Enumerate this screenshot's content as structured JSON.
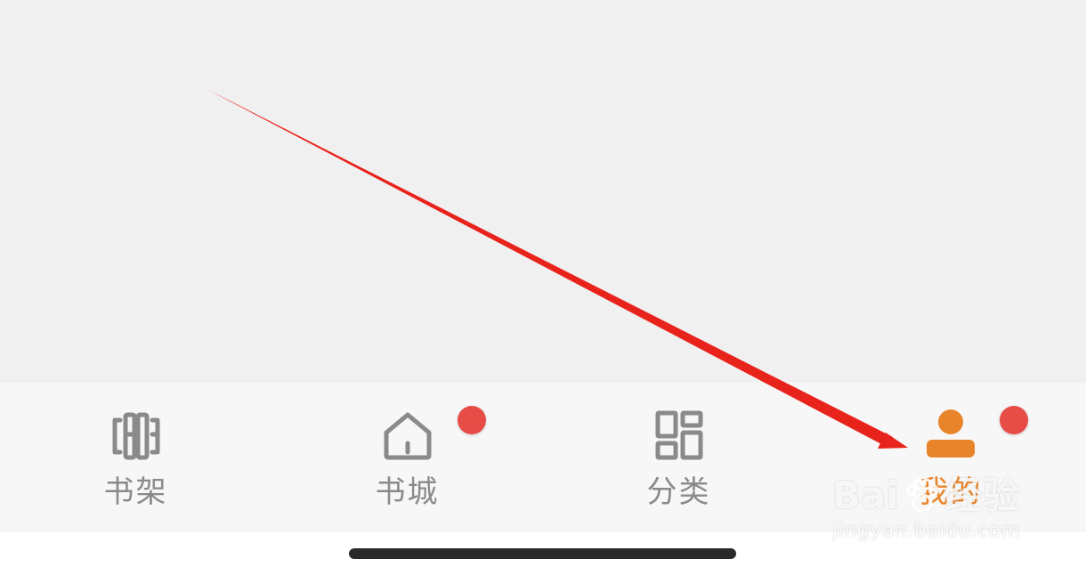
{
  "tabbar": {
    "tabs": [
      {
        "id": "bookshelf",
        "label": "书架",
        "icon": "bookshelf-icon",
        "active": false,
        "badge": false
      },
      {
        "id": "bookstore",
        "label": "书城",
        "icon": "home-icon",
        "active": false,
        "badge": true
      },
      {
        "id": "category",
        "label": "分类",
        "icon": "grid-icon",
        "active": false,
        "badge": false
      },
      {
        "id": "mine",
        "label": "我的",
        "icon": "user-icon",
        "active": true,
        "badge": true
      }
    ]
  },
  "colors": {
    "content_bg": "#f1f0f1",
    "tabbar_bg": "#f7f7f7",
    "inactive": "#8a8a8a",
    "active": "#e8852a",
    "badge": "#e74c46",
    "annotation_arrow": "#e8231c"
  },
  "annotation": {
    "type": "arrow",
    "points_to": "tab-mine"
  },
  "watermark": {
    "logo_text_a": "Bai",
    "logo_text_b": "经验",
    "url": "jingyan.baidu.com"
  }
}
